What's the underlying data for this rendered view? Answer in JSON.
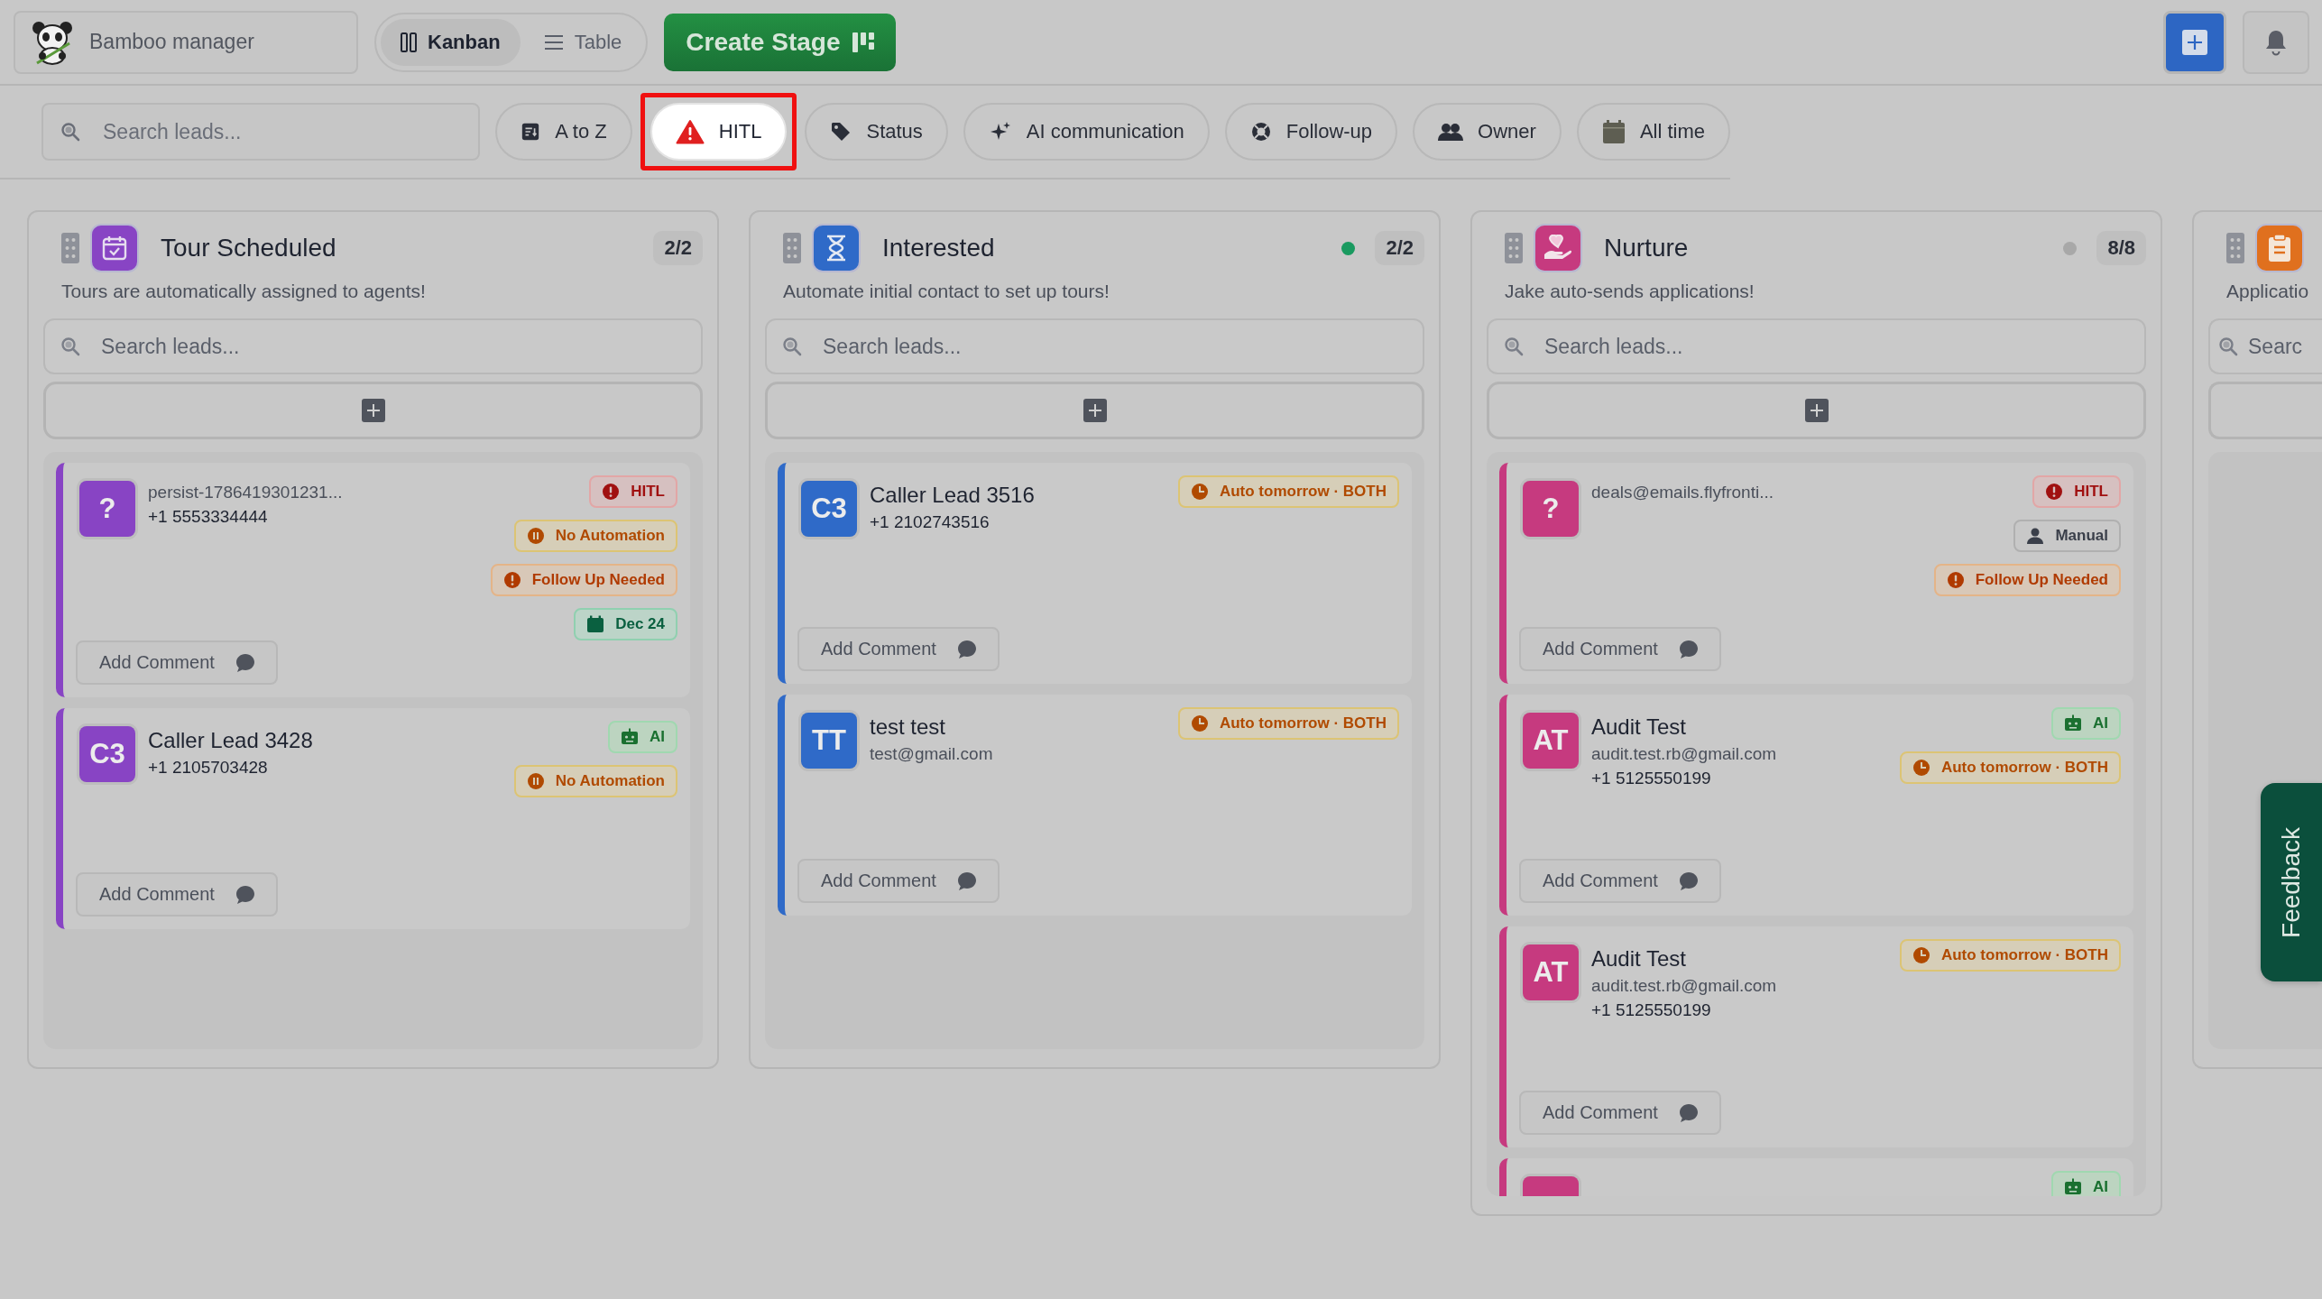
{
  "topbar": {
    "workspace": "Bamboo manager",
    "views": [
      {
        "label": "Kanban",
        "kind": "kanban",
        "selected": true
      },
      {
        "label": "Table",
        "kind": "table",
        "selected": false
      }
    ],
    "create_button": "Create Stage"
  },
  "filters": {
    "search_placeholder": "Search leads...",
    "buttons": [
      {
        "label": "A to Z",
        "kind": "sort",
        "highlighted": false
      },
      {
        "label": "HITL",
        "kind": "hitl",
        "highlighted": true
      },
      {
        "label": "Status",
        "kind": "status",
        "highlighted": false
      },
      {
        "label": "AI communication",
        "kind": "ai",
        "highlighted": false
      },
      {
        "label": "Follow-up",
        "kind": "followup",
        "highlighted": false
      },
      {
        "label": "Owner",
        "kind": "owner",
        "highlighted": false
      },
      {
        "label": "All time",
        "kind": "time",
        "highlighted": false
      }
    ]
  },
  "columns": [
    {
      "title": "Tour Scheduled",
      "color": "#8844c4",
      "count": "2/2",
      "description": "Tours are automatically assigned to agents!",
      "search_placeholder": "Search leads...",
      "cards": [
        {
          "avatar": "?",
          "lines": [
            {
              "kind": "contact",
              "text": "persist-1786419301231..."
            },
            {
              "kind": "phone",
              "text": "+1 5553334444"
            }
          ],
          "badges": [
            {
              "kind": "hitl",
              "label": "HITL"
            },
            {
              "kind": "paused",
              "label": "No Automation"
            },
            {
              "kind": "followup",
              "label": "Follow Up Needed"
            },
            {
              "kind": "date",
              "label": "Dec 24"
            }
          ],
          "comment_button": "Add Comment"
        },
        {
          "avatar": "C3",
          "lines": [
            {
              "kind": "name",
              "text": "Caller Lead 3428"
            },
            {
              "kind": "phone",
              "text": "+1 2105703428"
            }
          ],
          "badges": [
            {
              "kind": "ai",
              "label": "AI"
            },
            {
              "kind": "paused",
              "label": "No Automation"
            }
          ],
          "comment_button": "Add Comment"
        }
      ]
    },
    {
      "title": "Interested",
      "color": "#2f6ac8",
      "status_dot": {
        "color": "#1a9a60"
      },
      "count": "2/2",
      "description": "Automate initial contact to set up tours!",
      "search_placeholder": "Search leads...",
      "cards": [
        {
          "avatar": "C3",
          "lines": [
            {
              "kind": "name",
              "text": "Caller Lead 3516"
            },
            {
              "kind": "phone",
              "text": "+1 2102743516"
            }
          ],
          "badges": [
            {
              "kind": "auto",
              "label": "Auto tomorrow · BOTH"
            }
          ],
          "comment_button": "Add Comment"
        },
        {
          "avatar": "TT",
          "lines": [
            {
              "kind": "name",
              "text": "test test"
            },
            {
              "kind": "contact",
              "text": "test@gmail.com"
            }
          ],
          "badges": [
            {
              "kind": "auto",
              "label": "Auto tomorrow · BOTH"
            }
          ],
          "comment_button": "Add Comment"
        }
      ]
    },
    {
      "title": "Nurture",
      "color": "#c63a7f",
      "status_dot": {
        "color": "#a8a8a8"
      },
      "count": "8/8",
      "description": "Jake auto-sends applications!",
      "search_placeholder": "Search leads...",
      "cards": [
        {
          "avatar": "?",
          "lines": [
            {
              "kind": "contact",
              "text": "deals@emails.flyfronti..."
            }
          ],
          "badges": [
            {
              "kind": "hitl",
              "label": "HITL"
            },
            {
              "kind": "manual",
              "label": "Manual"
            },
            {
              "kind": "followup",
              "label": "Follow Up Needed"
            }
          ],
          "comment_button": "Add Comment"
        },
        {
          "avatar": "AT",
          "lines": [
            {
              "kind": "name",
              "text": "Audit Test"
            },
            {
              "kind": "contact",
              "text": "audit.test.rb@gmail.com"
            },
            {
              "kind": "phone",
              "text": "+1 5125550199"
            }
          ],
          "badges": [
            {
              "kind": "ai",
              "label": "AI"
            },
            {
              "kind": "auto",
              "label": "Auto tomorrow · BOTH"
            }
          ],
          "comment_button": "Add Comment"
        },
        {
          "avatar": "AT",
          "lines": [
            {
              "kind": "name",
              "text": "Audit Test"
            },
            {
              "kind": "contact",
              "text": "audit.test.rb@gmail.com"
            },
            {
              "kind": "phone",
              "text": "+1 5125550199"
            }
          ],
          "badges": [
            {
              "kind": "auto",
              "label": "Auto tomorrow · BOTH"
            }
          ],
          "comment_button": "Add Comment"
        },
        {
          "badges": [
            {
              "kind": "ai",
              "label": "AI"
            }
          ]
        }
      ]
    },
    {
      "color": "#e0701e",
      "description": "Applicatio",
      "search_placeholder": "Searc"
    }
  ],
  "feedback": "Feedback"
}
